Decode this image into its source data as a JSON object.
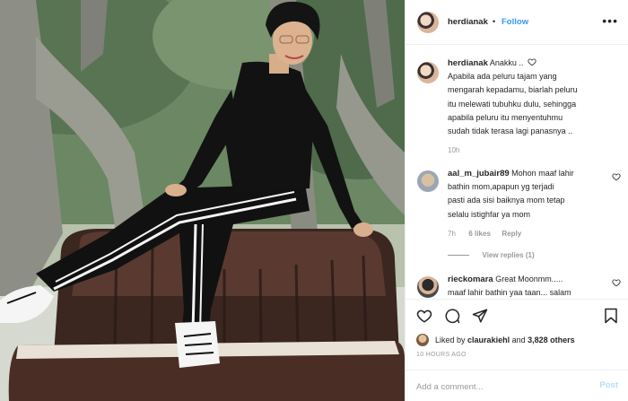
{
  "header": {
    "username": "herdianak",
    "separator": "•",
    "follow_label": "Follow",
    "more_icon": "ellipsis-icon"
  },
  "caption": {
    "username": "herdianak",
    "text_line1": "Anakku ..",
    "text_lines": [
      "Apabila ada peluru tajam yang",
      "mengarah kepadamu, biarlah peluru",
      "itu melewati tubuhku dulu, sehingga",
      "apabila peluru itu menyentuhmu",
      "sudah tidak terasa lagi panasnya .."
    ],
    "time": "10h"
  },
  "comments": [
    {
      "username": "aal_m_jubair89",
      "first_line": "Mohon maaf lahir",
      "lines": [
        "bathin mom,apapun yg terjadi",
        "pasti ada sisi baiknya mom tetap",
        "selalu istighfar ya mom"
      ],
      "time": "7h",
      "likes": "6 likes",
      "reply_label": "Reply",
      "view_replies": "View replies (1)"
    },
    {
      "username": "rieckomara",
      "first_line": "Great Moonmm.....",
      "lines": [
        "maaf lahir bathin yaa taan... salam"
      ]
    }
  ],
  "actions": {
    "icons": [
      "heart-icon",
      "comment-icon",
      "share-icon",
      "bookmark-icon"
    ]
  },
  "likes": {
    "prefix": "Liked by",
    "user": "claurakiehl",
    "and": "and",
    "count": "3,828 others"
  },
  "timestamp": "10 HOURS AGO",
  "add_comment": {
    "placeholder": "Add a comment...",
    "post_label": "Post"
  },
  "colors": {
    "accent": "#3897f0",
    "muted": "#999999",
    "border": "#efefef",
    "post_disabled": "#b2dffc"
  }
}
